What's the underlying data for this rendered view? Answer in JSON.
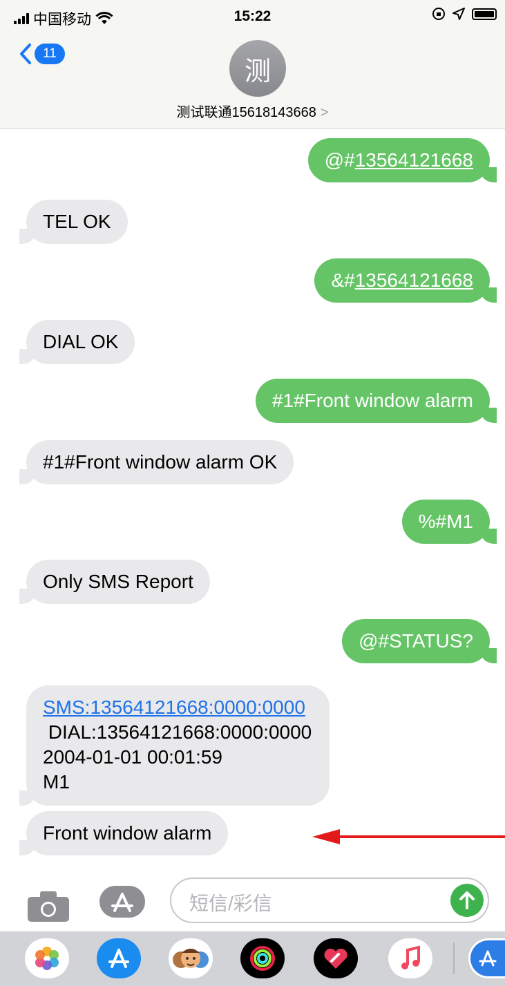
{
  "status_bar": {
    "carrier": "中国移动",
    "time": "15:22"
  },
  "header": {
    "back_count": "11",
    "avatar_initial": "测",
    "contact_name": "测试联通15618143668",
    "chevron": ">"
  },
  "messages": [
    {
      "direction": "outgoing",
      "prefix": "@#",
      "link": "13564121668"
    },
    {
      "direction": "incoming",
      "text": "TEL OK"
    },
    {
      "direction": "outgoing",
      "prefix": "&#",
      "link": "13564121668"
    },
    {
      "direction": "incoming",
      "text": "DIAL OK"
    },
    {
      "direction": "outgoing",
      "text": "#1#Front window alarm"
    },
    {
      "direction": "incoming",
      "text": "#1#Front window alarm OK"
    },
    {
      "direction": "outgoing",
      "text": "%#M1"
    },
    {
      "direction": "incoming",
      "text": "Only SMS Report"
    },
    {
      "direction": "outgoing",
      "text": "@#STATUS?"
    },
    {
      "direction": "incoming",
      "link": "SMS:13564121668:0000:0000",
      "lines": [
        " DIAL:13564121668:0000:0000",
        "2004-01-01 00:01:59",
        "M1"
      ]
    },
    {
      "direction": "incoming",
      "text": "Front window alarm"
    }
  ],
  "input": {
    "placeholder": "短信/彩信"
  },
  "dock": {
    "apps": [
      "photos-icon",
      "app-store-icon",
      "memoji-icon",
      "activity-icon",
      "digital-touch-icon",
      "music-icon",
      "app-store-more-icon"
    ]
  },
  "colors": {
    "outgoing_bubble": "#65c466",
    "incoming_bubble": "#e9e9eb",
    "link_blue": "#1f73e6",
    "badge_blue": "#1878f3",
    "annotation_arrow": "#e41a1a"
  }
}
